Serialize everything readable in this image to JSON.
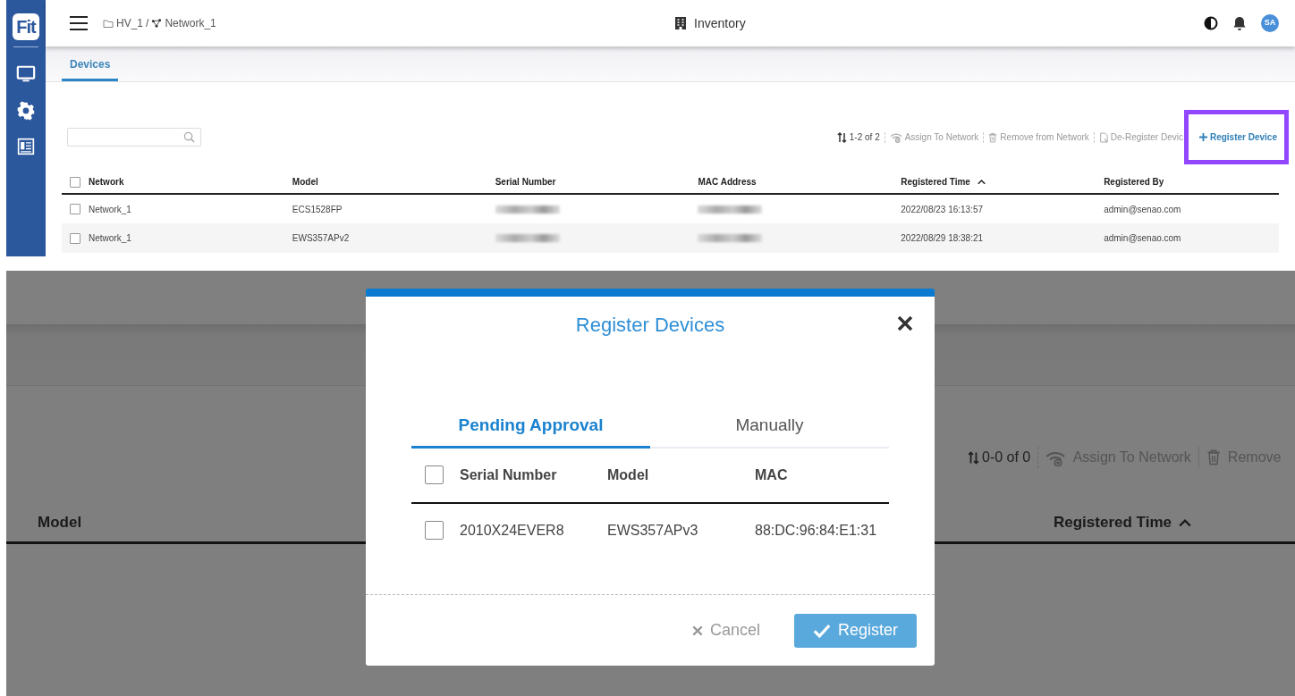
{
  "logo": "Fit",
  "breadcrumb": {
    "separator": "/",
    "items": [
      {
        "kind": "folder",
        "label": "HV_1"
      },
      {
        "kind": "network",
        "label": "Network_1"
      }
    ]
  },
  "page_title": "Inventory",
  "avatar": "SA",
  "tabs": [
    {
      "label": "Devices",
      "selected": true
    }
  ],
  "toolbar": {
    "count": "1-2 of 2",
    "actions": [
      {
        "kind": "assign",
        "label": "Assign To Network",
        "disabled": true,
        "highlighted": false
      },
      {
        "kind": "remove",
        "label": "Remove from Network",
        "disabled": true,
        "highlighted": false
      },
      {
        "kind": "deregister",
        "label": "De-Register Devic",
        "disabled": true,
        "highlighted": false
      },
      {
        "kind": "register",
        "label": "Register Device",
        "disabled": false,
        "highlighted": true
      }
    ]
  },
  "table": {
    "all_checked": false,
    "columns": [
      {
        "label": "Network",
        "sorted": false
      },
      {
        "label": "Model",
        "sorted": false
      },
      {
        "label": "Serial Number",
        "sorted": false
      },
      {
        "label": "MAC Address",
        "sorted": false
      },
      {
        "label": "Registered Time",
        "sorted": true
      },
      {
        "label": "Registered By",
        "sorted": false
      }
    ],
    "rows": [
      {
        "checked": false,
        "cells": [
          {
            "kind": "text",
            "text": "Network_1"
          },
          {
            "kind": "text",
            "text": "ECS1528FP"
          },
          {
            "kind": "redacted"
          },
          {
            "kind": "redacted"
          },
          {
            "kind": "text",
            "text": "2022/08/23 16:13:57"
          },
          {
            "kind": "text",
            "text": "admin@senao.com"
          }
        ]
      },
      {
        "checked": false,
        "cells": [
          {
            "kind": "text",
            "text": "Network_1"
          },
          {
            "kind": "text",
            "text": "EWS357APv2"
          },
          {
            "kind": "redacted"
          },
          {
            "kind": "redacted"
          },
          {
            "kind": "text",
            "text": "2022/08/29 18:38:21"
          },
          {
            "kind": "text",
            "text": "admin@senao.com"
          }
        ]
      }
    ]
  },
  "zoomed_view": {
    "toolbar": {
      "count": "0-0 of 0",
      "actions": [
        {
          "kind": "assign",
          "label": "Assign To Network"
        },
        {
          "kind": "remove",
          "label": "Remove"
        }
      ]
    },
    "columns": [
      {
        "label": "Model",
        "sorted": false
      },
      {
        "label": "Registered Time",
        "sorted": true
      }
    ]
  },
  "dialog": {
    "title": "Register Devices",
    "tabs": [
      {
        "label": "Pending Approval",
        "selected": true
      },
      {
        "label": "Manually",
        "selected": false
      }
    ],
    "all_checked": false,
    "columns": [
      "Serial Number",
      "Model",
      "MAC"
    ],
    "rows": [
      {
        "checked": false,
        "cells": [
          "2010X24EVER8",
          "EWS357APv3",
          "88:DC:96:84:E1:31"
        ]
      }
    ],
    "buttons": [
      {
        "kind": "cancel",
        "label": "Cancel"
      },
      {
        "kind": "confirm",
        "label": "Register"
      }
    ]
  }
}
